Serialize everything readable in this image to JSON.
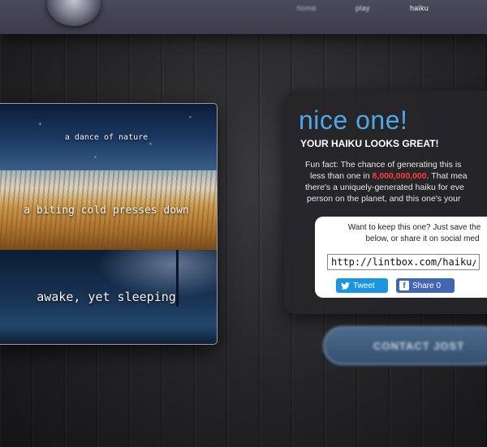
{
  "nav": {
    "items": [
      "home",
      "play",
      "haiku"
    ]
  },
  "card": {
    "lines": [
      "a dance of nature",
      "a biting cold presses down",
      "awake, yet sleeping"
    ]
  },
  "result": {
    "title": "nice one!",
    "subtitle": "YOUR HAIKU LOOKS GREAT!",
    "funfact": {
      "line1": "Fun fact: The chance of generating this is",
      "line2_pre": "less than one in ",
      "odds": "8,000,000,000",
      "line2_post": ". That mea",
      "line3": "there's a uniquely-generated haiku for eve",
      "line4": "person on the planet, and this one's your"
    }
  },
  "share": {
    "line1": "Want to keep this one? Just save the",
    "line2": "below, or share it on social med",
    "url": "http://lintbox.com/haiku/?;",
    "tweet_label": "Tweet",
    "fb_label": "Share 0"
  },
  "cta": {
    "label": "CONTACT JOST"
  },
  "colors": {
    "accent": "#4fa6e8",
    "odds": "#ff3d3d",
    "twitter": "#1b95e0",
    "facebook": "#4267b2"
  },
  "icons": {
    "tweet": "twitter-bird-icon",
    "share": "facebook-icon"
  }
}
